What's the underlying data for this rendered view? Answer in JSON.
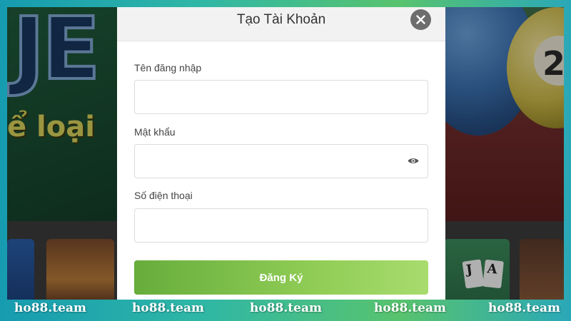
{
  "modal": {
    "title": "Tạo Tài Khoản",
    "close_icon": "close-icon",
    "fields": [
      {
        "label": "Tên đăng nhập",
        "value": "",
        "placeholder": ""
      },
      {
        "label": "Mật khẩu",
        "value": "",
        "placeholder": "",
        "toggle_icon": "eye-icon"
      },
      {
        "label": "Số điện thoại",
        "value": "",
        "placeholder": ""
      }
    ],
    "submit_label": "Đăng Ký"
  },
  "background": {
    "banner_fragment": "ể loại",
    "banner_letters": "JE",
    "ball_number": "2",
    "cards": [
      "J",
      "A"
    ]
  },
  "watermarks": [
    "ho88.team",
    "ho88.team",
    "ho88.team",
    "ho88.team",
    "ho88.team"
  ],
  "colors": {
    "accent_green": "#7cbd48",
    "frame_teal": "#1c9fb0",
    "close_button": "#6d6d6d",
    "header_bg": "#f2f2f2"
  }
}
